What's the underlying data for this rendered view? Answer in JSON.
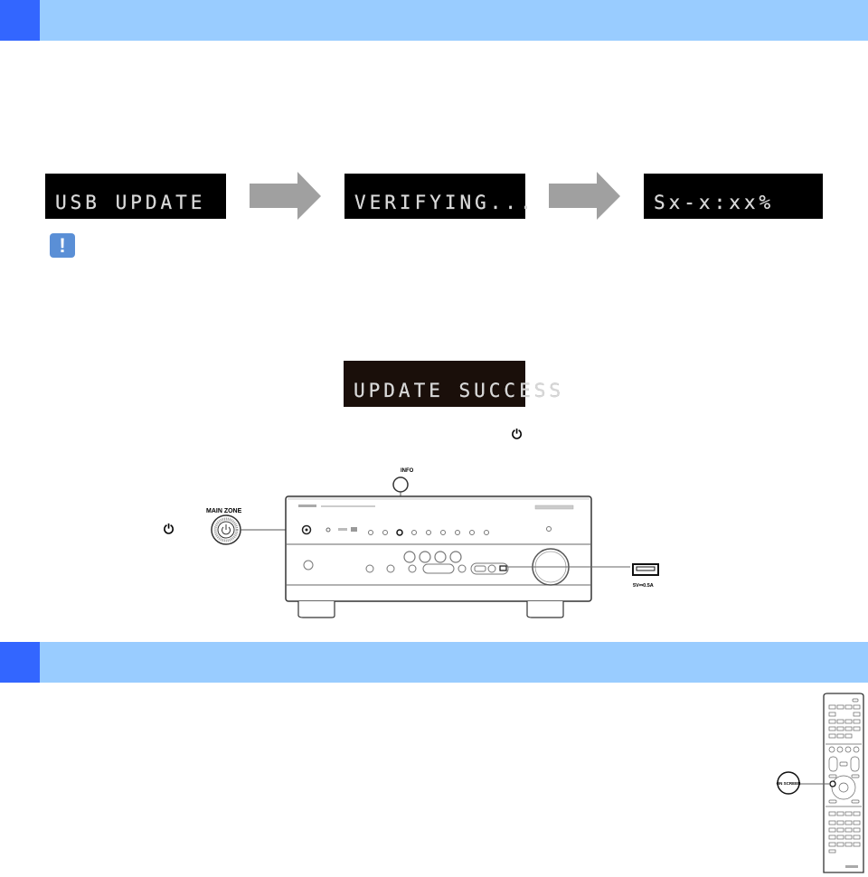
{
  "sections": [
    {
      "header_label": ""
    },
    {
      "header_label": ""
    }
  ],
  "displays": {
    "step1": "USB UPDATE",
    "step2": "VERIFYING...",
    "step3": "Sx-x:xx%",
    "success": "UPDATE SUCCESS"
  },
  "icons": {
    "note": "!",
    "power": "⏻"
  },
  "front_panel": {
    "info_label": "INFO",
    "main_zone_label": "MAIN ZONE",
    "usb_label": "5V⎓0.5A"
  },
  "remote": {
    "callout_label": "ON SCREEN"
  },
  "colors": {
    "header_light": "#99ccff",
    "header_dark": "#3366ff",
    "note_blue": "#5a8fd6",
    "arrow_gray": "#a0a0a0"
  }
}
